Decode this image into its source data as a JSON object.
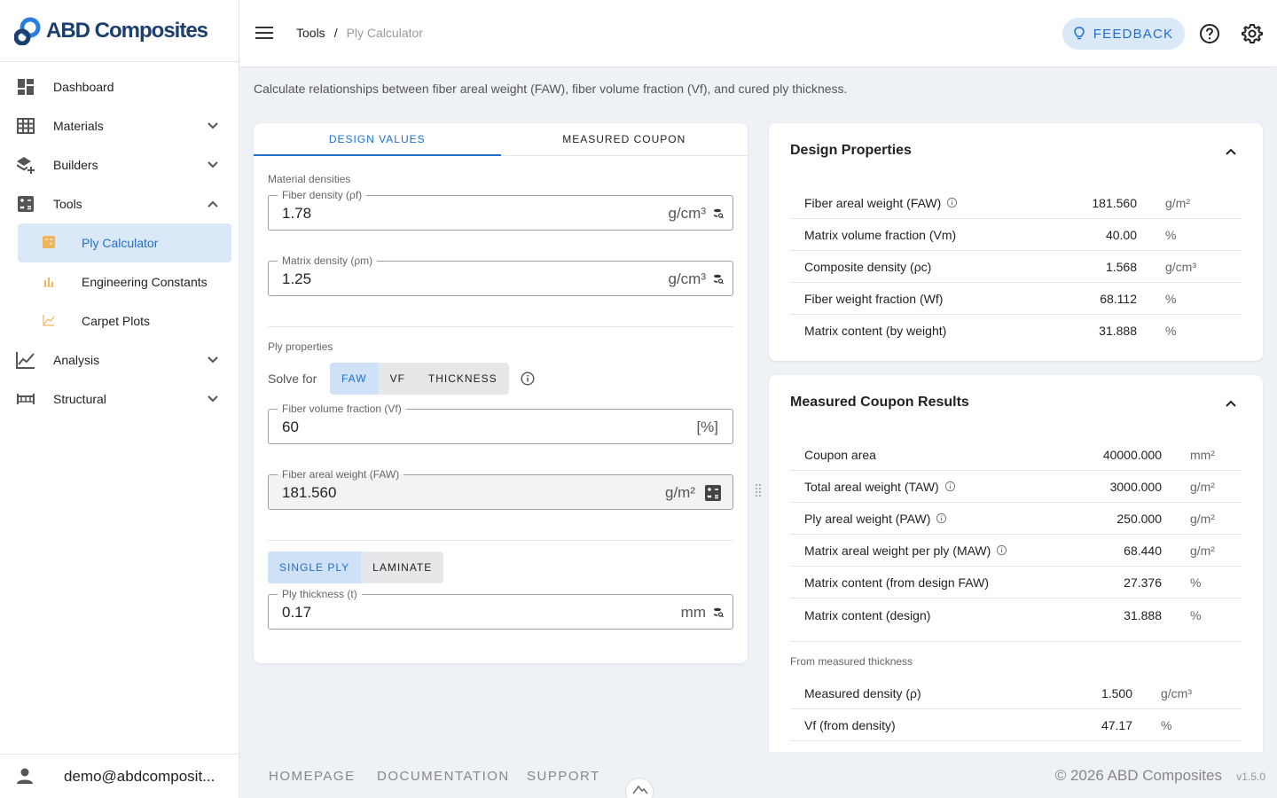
{
  "app": {
    "logo_text": "ABD Composites"
  },
  "sidebar": {
    "items": [
      {
        "label": "Dashboard",
        "icon": "dashboard-icon"
      },
      {
        "label": "Materials",
        "icon": "table-grid-icon"
      },
      {
        "label": "Builders",
        "icon": "layers-add-icon"
      },
      {
        "label": "Tools",
        "icon": "calculator-box-icon"
      },
      {
        "label": "Analysis",
        "icon": "line-chart-icon"
      },
      {
        "label": "Structural",
        "icon": "beam-icon"
      }
    ],
    "tools_sub": [
      {
        "label": "Ply Calculator",
        "icon": "calculator-icon",
        "active": true
      },
      {
        "label": "Engineering Constants",
        "icon": "bar-chart-icon"
      },
      {
        "label": "Carpet Plots",
        "icon": "area-chart-icon"
      }
    ],
    "user": "demo@abdcomposit..."
  },
  "header": {
    "breadcrumb_root": "Tools",
    "breadcrumb_sep": "/",
    "breadcrumb_current": "Ply Calculator",
    "feedback_label": "FEEDBACK"
  },
  "intro": "Calculate relationships between fiber areal weight (FAW), fiber volume fraction (Vf), and cured ply thickness.",
  "left": {
    "tabs": [
      "DESIGN VALUES",
      "MEASURED COUPON"
    ],
    "material_densities_label": "Material densities",
    "fiber_density": {
      "label": "Fiber density (ρf)",
      "value": "1.78",
      "unit": "g/cm³"
    },
    "matrix_density": {
      "label": "Matrix density (ρm)",
      "value": "1.25",
      "unit": "g/cm³"
    },
    "ply_properties_label": "Ply properties",
    "solve_for_label": "Solve for",
    "solve_options": [
      "FAW",
      "VF",
      "THICKNESS"
    ],
    "vf": {
      "label": "Fiber volume fraction (Vf)",
      "value": "60",
      "unit": "[%]"
    },
    "faw": {
      "label": "Fiber areal weight (FAW)",
      "value": "181.560",
      "unit": "g/m²"
    },
    "mode_options": [
      "SINGLE PLY",
      "LAMINATE"
    ],
    "thickness": {
      "label": "Ply thickness (t)",
      "value": "0.17",
      "unit": "mm"
    }
  },
  "design": {
    "title": "Design Properties",
    "rows": [
      {
        "label": "Fiber areal weight (FAW)",
        "value": "181.560",
        "unit": "g/m²",
        "info": true
      },
      {
        "label": "Matrix volume fraction (Vm)",
        "value": "40.00",
        "unit": "%"
      },
      {
        "label": "Composite density (ρc)",
        "value": "1.568",
        "unit": "g/cm³"
      },
      {
        "label": "Fiber weight fraction (Wf)",
        "value": "68.112",
        "unit": "%"
      },
      {
        "label": "Matrix content (by weight)",
        "value": "31.888",
        "unit": "%"
      }
    ]
  },
  "coupon": {
    "title": "Measured Coupon Results",
    "rows": [
      {
        "label": "Coupon area",
        "value": "40000.000",
        "unit": "mm²"
      },
      {
        "label": "Total areal weight (TAW)",
        "value": "3000.000",
        "unit": "g/m²",
        "info": true
      },
      {
        "label": "Ply areal weight (PAW)",
        "value": "250.000",
        "unit": "g/m²",
        "info": true
      },
      {
        "label": "Matrix areal weight per ply (MAW)",
        "value": "68.440",
        "unit": "g/m²",
        "info": true
      },
      {
        "label": "Matrix content (from design FAW)",
        "value": "27.376",
        "unit": "%"
      },
      {
        "label": "Matrix content (design)",
        "value": "31.888",
        "unit": "%"
      }
    ],
    "measured_label": "From measured thickness",
    "measured_rows": [
      {
        "label": "Measured density (ρ)",
        "value": "1.500",
        "unit": "g/cm³"
      },
      {
        "label": "Vf (from density)",
        "value": "47.17",
        "unit": "%"
      }
    ]
  },
  "footer": {
    "links": [
      "HOMEPAGE",
      "DOCUMENTATION",
      "SUPPORT"
    ],
    "copyright": "© 2026 ABD Composites",
    "version": "v1.5.0"
  },
  "colors": {
    "accent": "#1e6fd0",
    "accent_light": "#dbe8f7",
    "brand": "#1b3f6e",
    "sub_icon": "#f0b45a"
  }
}
